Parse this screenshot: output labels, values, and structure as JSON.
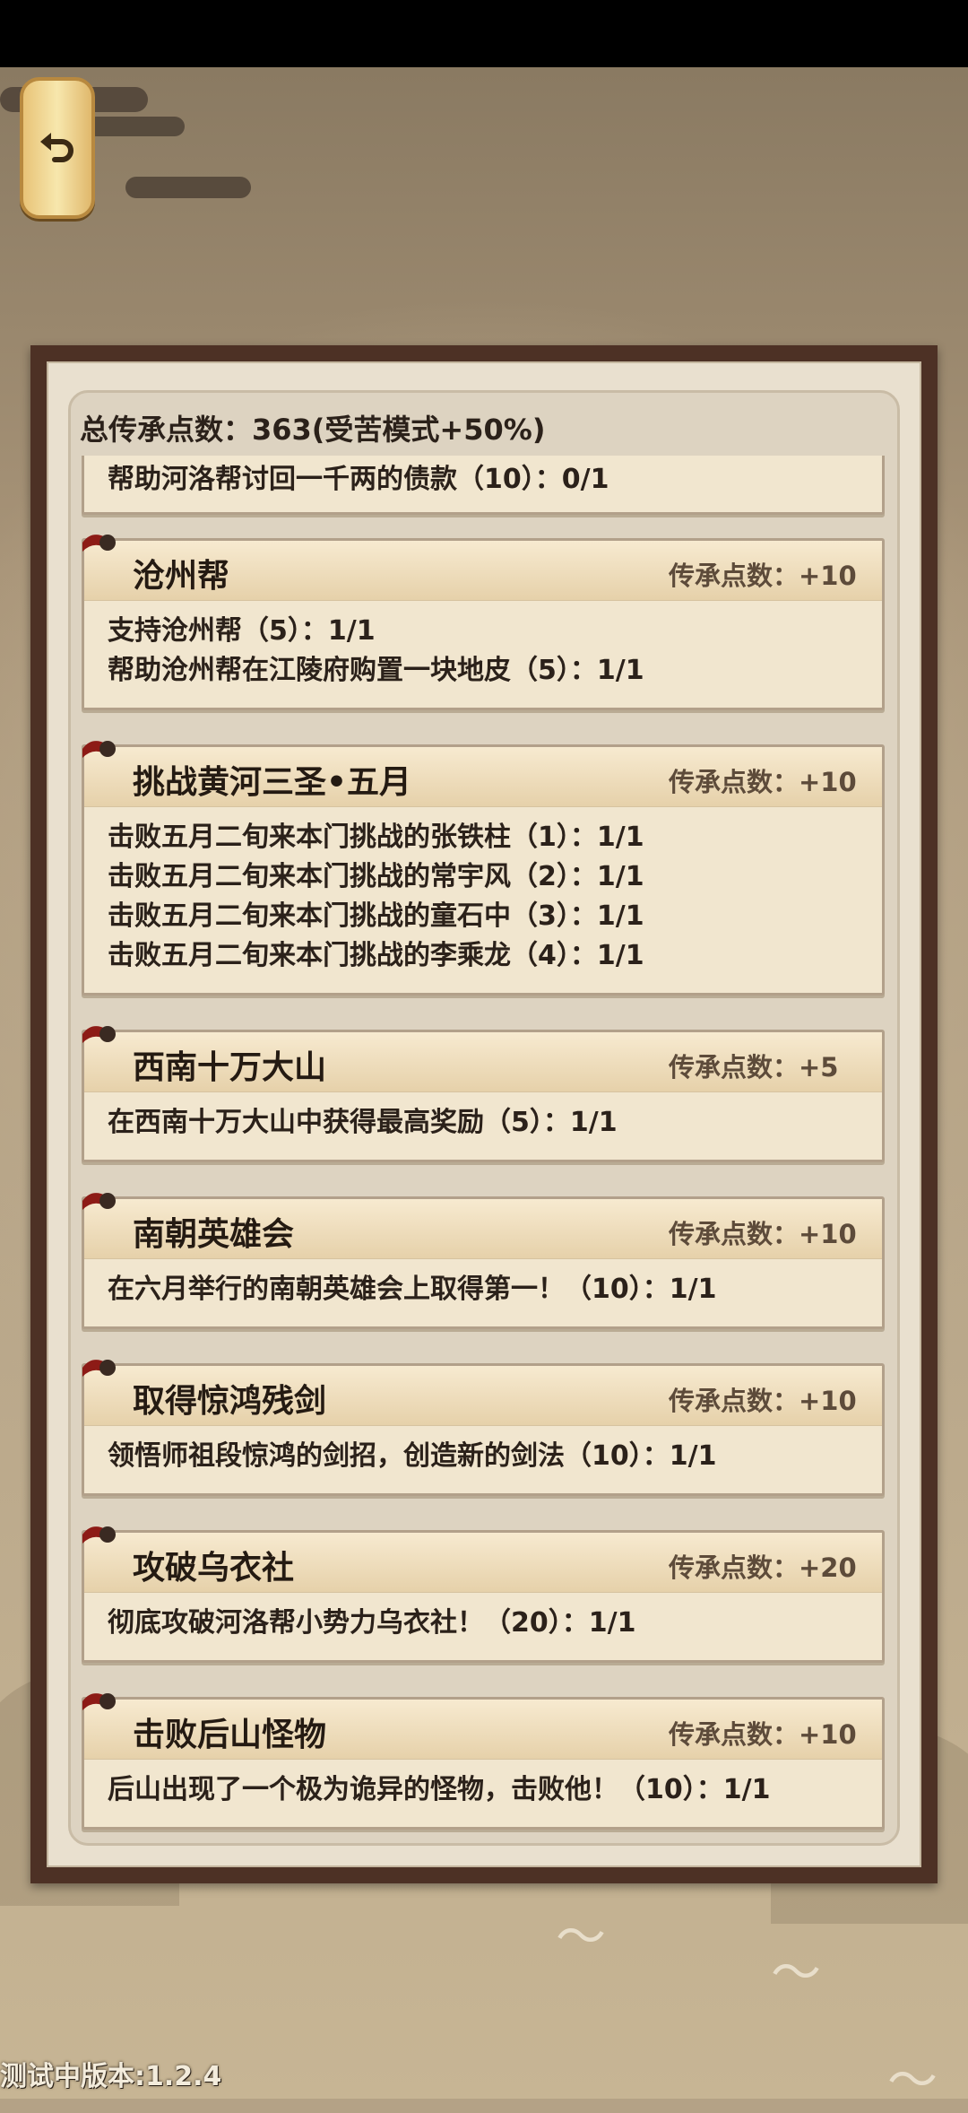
{
  "total_points": "总传承点数：363(受苦模式+50%)",
  "partial_card": {
    "line": "帮助河洛帮讨回一千两的债款（10）：0/1"
  },
  "cards": [
    {
      "title": "沧州帮",
      "points": "传承点数：+10",
      "lines": [
        "支持沧州帮（5）：1/1",
        "帮助沧州帮在江陵府购置一块地皮（5）：1/1"
      ]
    },
    {
      "title": "挑战黄河三圣•五月",
      "points": "传承点数：+10",
      "lines": [
        "击败五月二旬来本门挑战的张铁柱（1）：1/1",
        "击败五月二旬来本门挑战的常宇风（2）：1/1",
        "击败五月二旬来本门挑战的童石中（3）：1/1",
        "击败五月二旬来本门挑战的李乘龙（4）：1/1"
      ]
    },
    {
      "title": "西南十万大山",
      "points": "传承点数：+5",
      "lines": [
        "在西南十万大山中获得最高奖励（5）：1/1"
      ]
    },
    {
      "title": "南朝英雄会",
      "points": "传承点数：+10",
      "lines": [
        "在六月举行的南朝英雄会上取得第一！（10）：1/1"
      ]
    },
    {
      "title": "取得惊鸿残剑",
      "points": "传承点数：+10",
      "lines": [
        "领悟师祖段惊鸿的剑招，创造新的剑法（10）：1/1"
      ]
    },
    {
      "title": "攻破乌衣社",
      "points": "传承点数：+20",
      "lines": [
        "彻底攻破河洛帮小势力乌衣社！（20）：1/1"
      ]
    },
    {
      "title": "击败后山怪物",
      "points": "传承点数：+10",
      "lines": [
        "后山出现了一个极为诡异的怪物，击败他！（10）：1/1"
      ]
    }
  ],
  "version": "测试中版本:1.2.4",
  "colors": {
    "frame": "#4d3125",
    "card": "#f1e6cf",
    "button": "#f0d796"
  },
  "icons": {
    "back": "undo-arrow-icon",
    "ribbon": "ribbon-icon"
  }
}
